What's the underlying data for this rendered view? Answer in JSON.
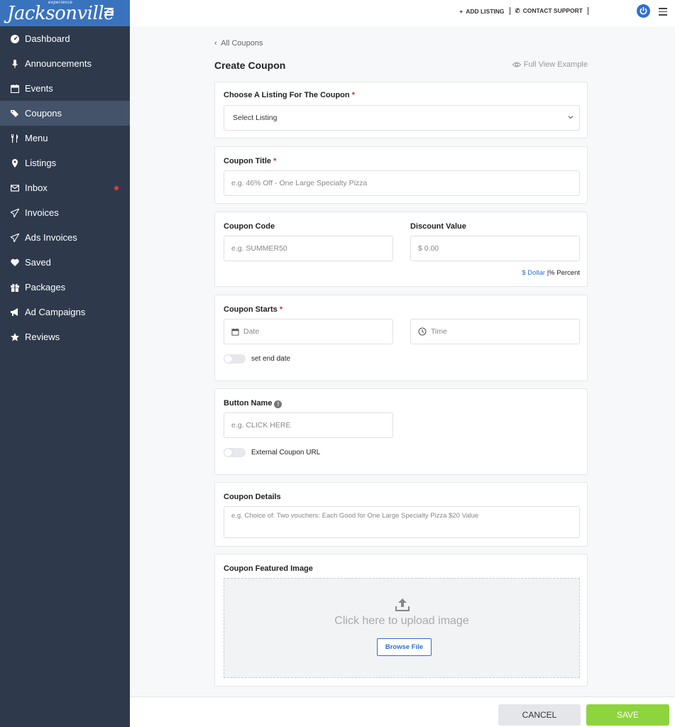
{
  "brand": {
    "superscript": "experience",
    "logo_text": "Jacksonville"
  },
  "sidebar": {
    "items": [
      {
        "label": "Dashboard",
        "icon": "dashboard-icon"
      },
      {
        "label": "Announcements",
        "icon": "microphone-icon"
      },
      {
        "label": "Events",
        "icon": "calendar-icon"
      },
      {
        "label": "Coupons",
        "icon": "tags-icon",
        "active": true
      },
      {
        "label": "Menu",
        "icon": "utensils-icon"
      },
      {
        "label": "Listings",
        "icon": "map-marker-icon"
      },
      {
        "label": "Inbox",
        "icon": "envelope-icon",
        "badge": "red-dot"
      },
      {
        "label": "Invoices",
        "icon": "paper-plane-icon"
      },
      {
        "label": "Ads Invoices",
        "icon": "paper-plane-icon"
      },
      {
        "label": "Saved",
        "icon": "heart-icon"
      },
      {
        "label": "Packages",
        "icon": "gift-icon"
      },
      {
        "label": "Ad Campaigns",
        "icon": "bullhorn-icon"
      },
      {
        "label": "Reviews",
        "icon": "star-icon"
      }
    ]
  },
  "topbar": {
    "add_listing": "ADD LISTING",
    "contact_support": "CONTACT SUPPORT"
  },
  "page": {
    "back_link": "All Coupons",
    "title": "Create Coupon",
    "full_view": "Full View Example"
  },
  "form": {
    "listing": {
      "label": "Choose A Listing For The Coupon",
      "required": "*",
      "selected": "Select Listing"
    },
    "title": {
      "label": "Coupon Title",
      "required": "*",
      "placeholder": "e.g. 46% Off -  One Large Specialty Pizza"
    },
    "code": {
      "label": "Coupon Code",
      "placeholder": "e.g. SUMMER50"
    },
    "discount": {
      "label": "Discount Value",
      "placeholder": "$ 0.00",
      "unit_dollar": "$ Dollar",
      "unit_separator": "|",
      "unit_percent": "% Percent"
    },
    "starts": {
      "label": "Coupon Starts",
      "required": "*",
      "date_placeholder": "Date",
      "time_placeholder": "Time",
      "end_toggle_label": "set end date"
    },
    "button_name": {
      "label": "Button Name",
      "info": "!",
      "placeholder": "e.g. CLICK HERE",
      "external_toggle_label": "External Coupon URL"
    },
    "details": {
      "label": "Coupon Details",
      "placeholder": "e.g. Choice of: Two vouchers: Each Good for One Large Specialty Pizza $20 Value"
    },
    "image": {
      "label": "Coupon Featured Image",
      "upload_text": "Click here to upload image",
      "browse_label": "Browse File"
    }
  },
  "footer": {
    "cancel": "CANCEL",
    "save": "SAVE"
  },
  "colors": {
    "sidebar_bg": "#2e3a4c",
    "brand_blue": "#3a73bd",
    "accent_blue": "#2f6fd0",
    "save_green": "#8ed43d",
    "required_red": "#d32f2f"
  }
}
